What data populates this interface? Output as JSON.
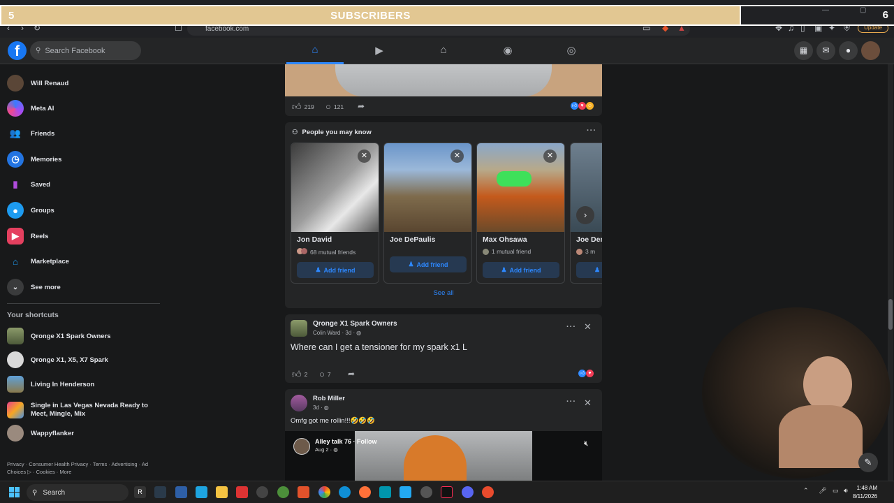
{
  "overlay": {
    "left_number": "5",
    "title": "SUBSCRIBERS",
    "right_number": "6"
  },
  "browser": {
    "url": "facebook.com",
    "update_label": "Update"
  },
  "header": {
    "search_placeholder": "Search Facebook"
  },
  "sidebar": {
    "items": [
      {
        "label": "Will Renaud",
        "icon": "profile-avatar"
      },
      {
        "label": "Meta AI",
        "icon": "meta-ai-icon"
      },
      {
        "label": "Friends",
        "icon": "friends-icon"
      },
      {
        "label": "Memories",
        "icon": "clock-icon"
      },
      {
        "label": "Saved",
        "icon": "bookmark-icon"
      },
      {
        "label": "Groups",
        "icon": "groups-icon"
      },
      {
        "label": "Reels",
        "icon": "reels-icon"
      },
      {
        "label": "Marketplace",
        "icon": "shop-icon"
      },
      {
        "label": "See more",
        "icon": "chevron-down-icon"
      }
    ],
    "shortcuts_title": "Your shortcuts",
    "shortcuts": [
      {
        "label": "Qronge X1 Spark Owners"
      },
      {
        "label": "Qronge X1, X5, X7 Spark"
      },
      {
        "label": "Living In Henderson"
      },
      {
        "label": "Single in Las Vegas Nevada Ready to Meet, Mingle, Mix"
      },
      {
        "label": "Wappyflanker"
      }
    ],
    "footer": "Privacy · Consumer Health Privacy · Terms · Advertising · Ad Choices ▷ · Cookies · More"
  },
  "feed": {
    "top_post": {
      "likes": "219",
      "comments": "121"
    },
    "pymk": {
      "title": "People you may know",
      "people": [
        {
          "name": "Jon David",
          "mutual": "68 mutual friends",
          "button": "Add friend"
        },
        {
          "name": "Joe DePaulis",
          "mutual": "",
          "button": "Add friend"
        },
        {
          "name": "Max Ohsawa",
          "mutual": "1 mutual friend",
          "button": "Add friend"
        },
        {
          "name": "Joe Den",
          "mutual": "3 m",
          "button": ""
        }
      ],
      "see_all": "See all"
    },
    "post1": {
      "group": "Qronge X1 Spark Owners",
      "meta": "Colin Ward · 3d · ",
      "text": "Where can I get a tensioner for my spark x1 L",
      "likes": "2",
      "comments": "7"
    },
    "post2": {
      "author": "Rob Miller",
      "meta": "3d · ",
      "text": "Omfg got me rollin!!!🤣🤣🤣",
      "shared_author": "Alley talk 76 · Follow",
      "shared_meta": "Aug 2 · "
    }
  },
  "taskbar": {
    "search_label": "Search",
    "time": "1:48 AM",
    "date": "8/11/2026"
  },
  "colors": {
    "fb_blue": "#1877f2",
    "accent_blue": "#2d88ff",
    "overlay_gold": "#e2c792",
    "background": "#18191a",
    "card": "#242526"
  }
}
